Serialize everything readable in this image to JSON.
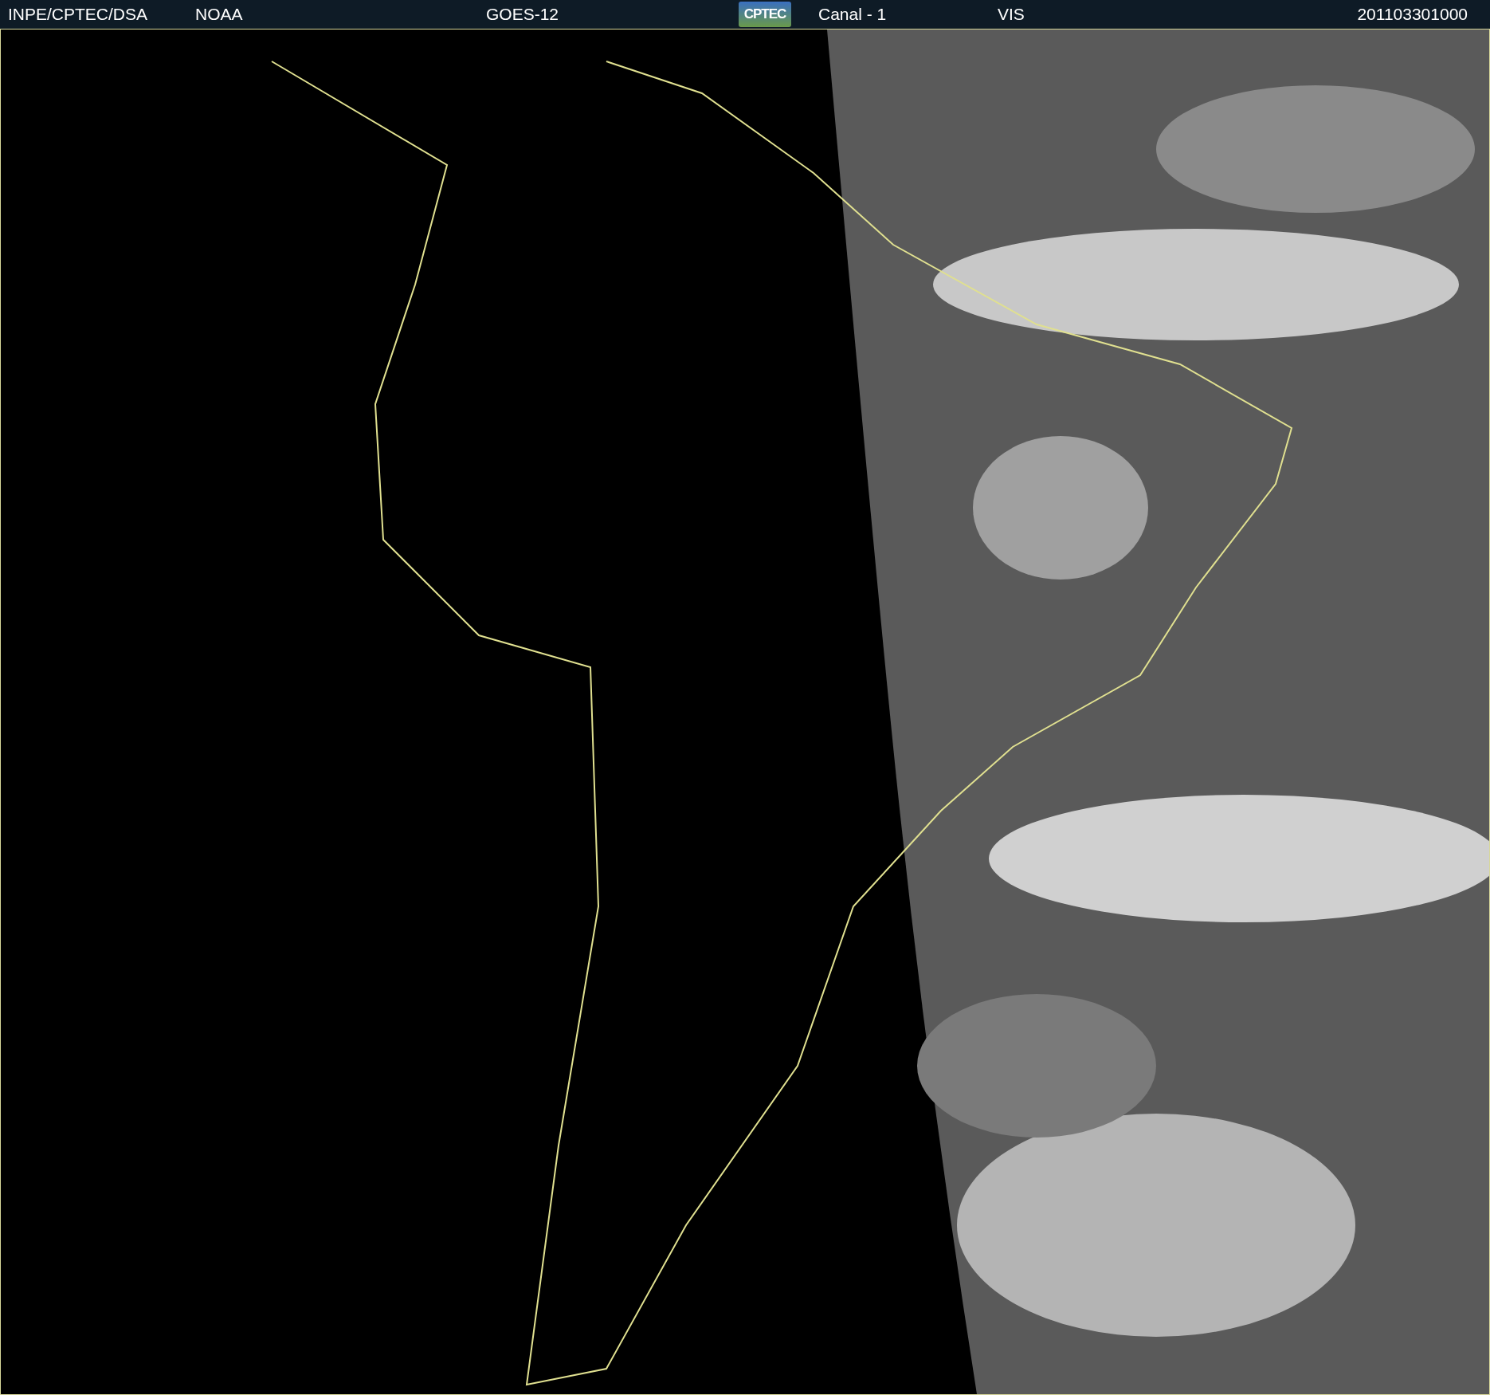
{
  "header": {
    "source": "INPE/CPTEC/DSA",
    "agency": "NOAA",
    "satellite": "GOES-12",
    "logo": "CPTEC",
    "channel": "Canal - 1",
    "band": "VIS",
    "timestamp": "201103301000"
  }
}
